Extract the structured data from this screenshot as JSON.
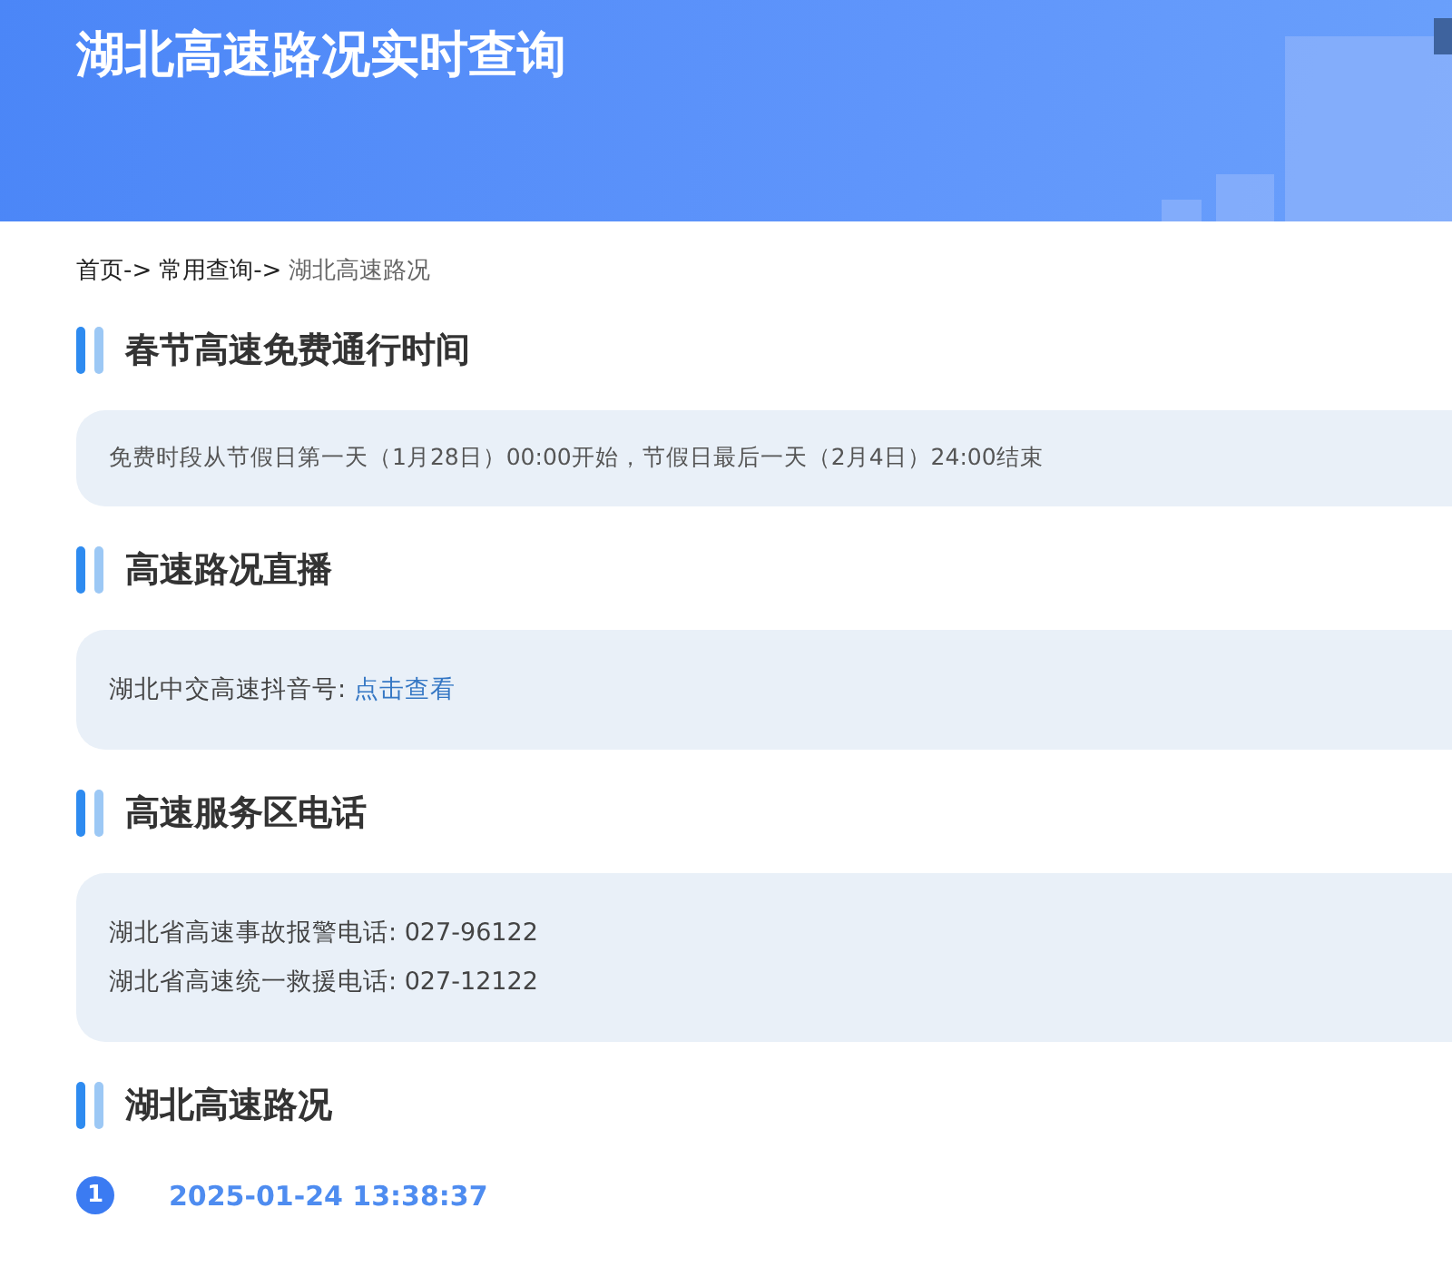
{
  "header": {
    "title": "湖北高速路况实时查询"
  },
  "breadcrumb": [
    {
      "label": "首页->",
      "current": false
    },
    {
      "label": "常用查询->",
      "current": false
    },
    {
      "label": "湖北高速路况",
      "current": true
    }
  ],
  "sections": [
    {
      "title": "春节高速免费通行时间",
      "kind": "note",
      "lines": [
        "免费时段从节假日第一天（1月28日）00:00开始，节假日最后一天（2月4日）24:00结束"
      ]
    },
    {
      "title": "高速路况直播",
      "kind": "link",
      "label": "湖北中交高速抖音号:",
      "link": "点击查看"
    },
    {
      "title": "高速服务区电话",
      "kind": "lines",
      "lines": [
        "湖北省高速事故报警电话: 027-96122",
        "湖北省高速统一救援电话: 027-12122"
      ]
    },
    {
      "title": "湖北高速路况",
      "kind": "timeline",
      "items": [
        {
          "number": "1",
          "time": "2025-01-24 13:38:37"
        }
      ]
    }
  ]
}
